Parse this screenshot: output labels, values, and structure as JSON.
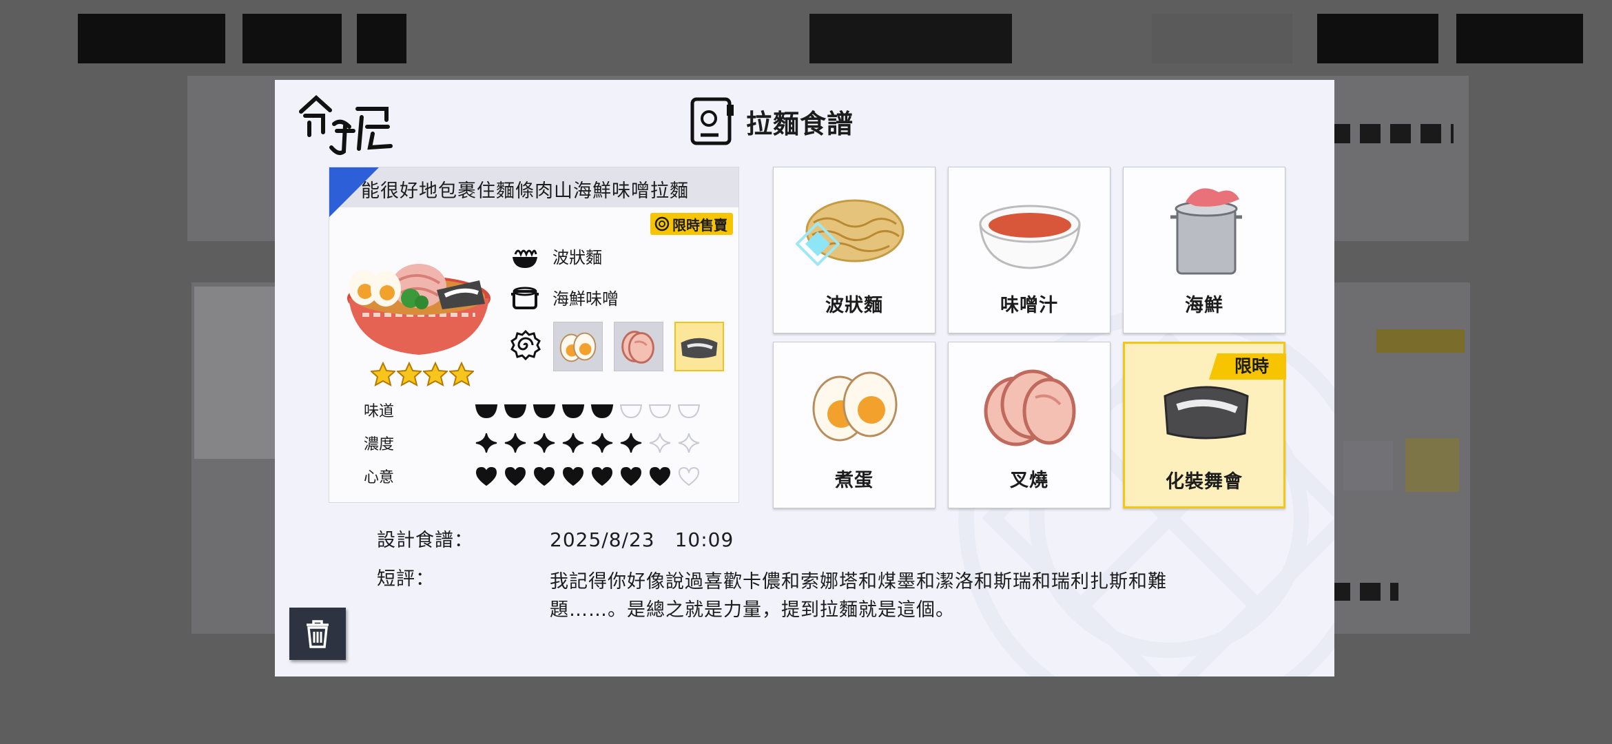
{
  "modal": {
    "logo_text": "命運屋",
    "title": "拉麵食譜",
    "recipe": {
      "name": "能很好地包裹住麵條肉山海鮮味噌拉麵",
      "limited_tag": "限時售賣",
      "stars": 4,
      "max_stars": 4,
      "components": [
        {
          "label": "波狀麵",
          "icon": "noodle-icon"
        },
        {
          "label": "海鮮味噌",
          "icon": "pot-icon"
        }
      ],
      "toppings_icon": "naruto-icon",
      "toppings": [
        {
          "name": "boiled-egg",
          "selected": false
        },
        {
          "name": "chashu",
          "selected": false
        },
        {
          "name": "masquerade",
          "selected": true
        }
      ],
      "stats": [
        {
          "label": "味道",
          "value": 5,
          "max": 8,
          "icon": "bowl"
        },
        {
          "label": "濃度",
          "value": 6,
          "max": 8,
          "icon": "sparkle"
        },
        {
          "label": "心意",
          "value": 7,
          "max": 8,
          "icon": "heart"
        }
      ]
    },
    "ingredients": [
      {
        "label": "波狀麵",
        "icon": "wavy-noodles-icon",
        "selected": false,
        "badge": ""
      },
      {
        "label": "味噌汁",
        "icon": "miso-soup-icon",
        "selected": false,
        "badge": ""
      },
      {
        "label": "海鮮",
        "icon": "seafood-pot-icon",
        "selected": false,
        "badge": ""
      },
      {
        "label": "煮蛋",
        "icon": "boiled-egg-icon",
        "selected": false,
        "badge": ""
      },
      {
        "label": "叉燒",
        "icon": "chashu-icon",
        "selected": false,
        "badge": ""
      },
      {
        "label": "化裝舞會",
        "icon": "masquerade-icon",
        "selected": true,
        "badge": "限時"
      }
    ],
    "design_label": "設計食譜：",
    "design_date": "2025/8/23　10:09",
    "review_label": "短評：",
    "review_text": "我記得你好像說過喜歡卡儂和索娜塔和煤墨和潔洛和斯瑞和瑞利扎斯和難題……。是總之就是力量，提到拉麵就是這個。"
  },
  "colors": {
    "accent_blue": "#2c5fd8",
    "limited_yellow": "#f7c500",
    "selected_bg": "#fdf0bd",
    "modal_bg": "#f1f2fa",
    "overlay": "#5e5e5e"
  }
}
